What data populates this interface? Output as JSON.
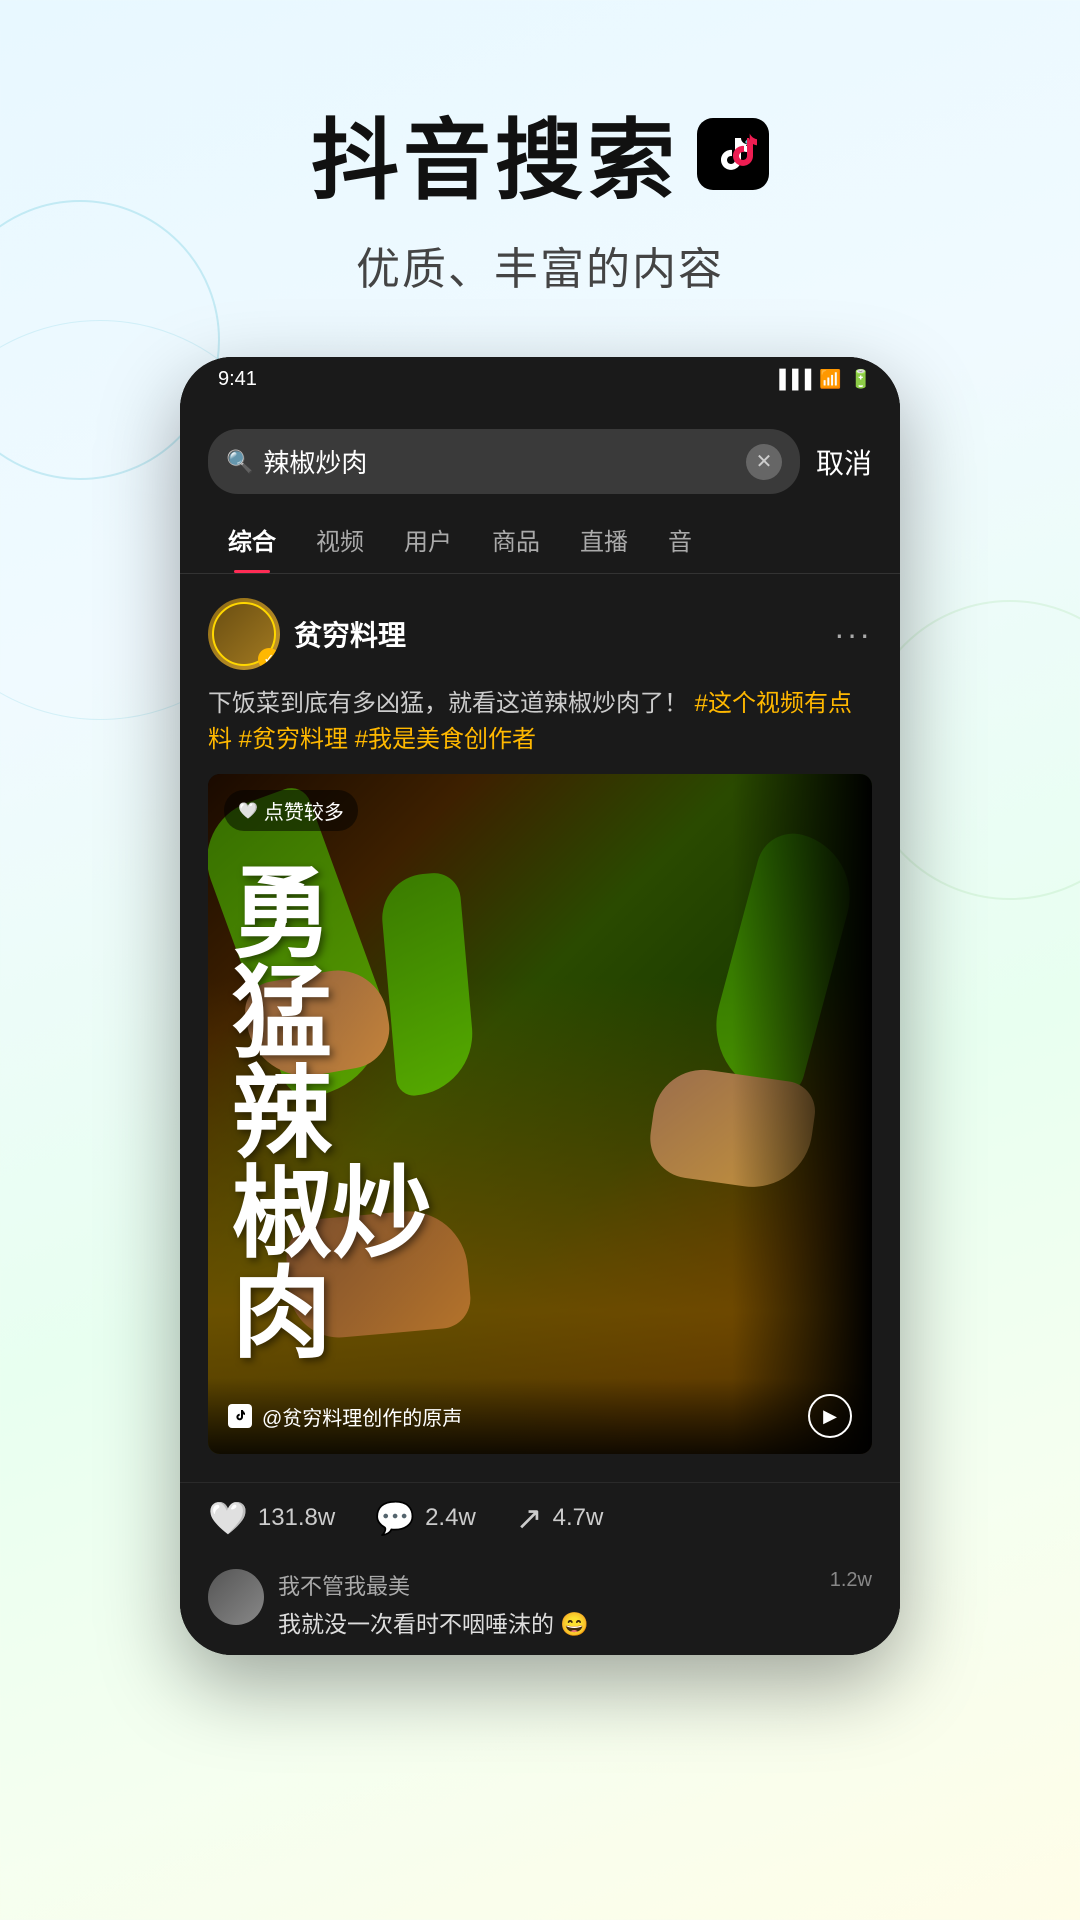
{
  "header": {
    "title": "抖音搜索",
    "subtitle": "优质、丰富的内容",
    "tiktok_icon_label": "tiktok-logo"
  },
  "phone": {
    "status_bar": {
      "time": "9:41",
      "icons": [
        "signal",
        "wifi",
        "battery"
      ]
    },
    "search_bar": {
      "query": "辣椒炒肉",
      "cancel_label": "取消",
      "placeholder": "搜索"
    },
    "tabs": [
      {
        "label": "综合",
        "active": true
      },
      {
        "label": "视频",
        "active": false
      },
      {
        "label": "用户",
        "active": false
      },
      {
        "label": "商品",
        "active": false
      },
      {
        "label": "直播",
        "active": false
      },
      {
        "label": "音",
        "active": false
      }
    ],
    "post": {
      "username": "贫穷料理",
      "verified": true,
      "description": "下饭菜到底有多凶猛，就看这道辣椒炒肉了！",
      "hashtags": [
        "#这个视频有点料",
        "#贫穷料理",
        "#我是美食创作者"
      ],
      "liked_badge": "点赞较多",
      "video_text": "勇猛的辣椒炒肉",
      "video_text_lines": [
        "勇",
        "猛",
        "辣",
        "椒炒",
        "肉"
      ],
      "audio": "@贫穷料理创作的原声",
      "likes": "131.8w",
      "comments": "2.4w",
      "shares": "4.7w"
    },
    "comments": [
      {
        "username": "我不管我最美",
        "text": "我就没一次看时不咽唾沫的 😄",
        "likes": "1.2w"
      }
    ]
  },
  "colors": {
    "accent": "#fe2c55",
    "hashtag": "#FFB800",
    "background_gradient_start": "#e8f8ff",
    "background_gradient_end": "#f5fff0",
    "phone_bg": "#111",
    "screen_bg": "#1a1a1a"
  }
}
